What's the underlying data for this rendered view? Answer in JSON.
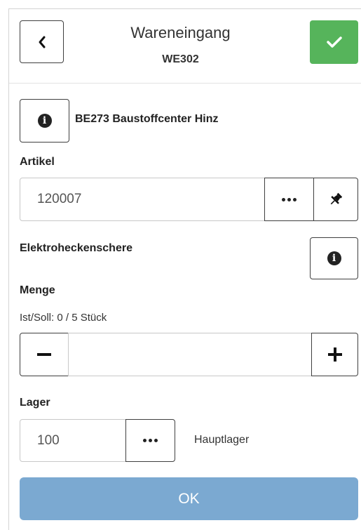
{
  "header": {
    "title": "Wareneingang",
    "subtitle": "WE302"
  },
  "supplier": {
    "text": "BE273 Baustoffcenter Hinz"
  },
  "article": {
    "label": "Artikel",
    "value": "120007",
    "description": "Elektroheckenschere"
  },
  "quantity": {
    "label": "Menge",
    "status": "Ist/Soll: 0 / 5 Stück",
    "value": ""
  },
  "storage": {
    "label": "Lager",
    "value": "100",
    "description": "Hauptlager"
  },
  "ok_button": "OK",
  "colors": {
    "confirm": "#56b45b",
    "ok": "#7ba9d1"
  }
}
